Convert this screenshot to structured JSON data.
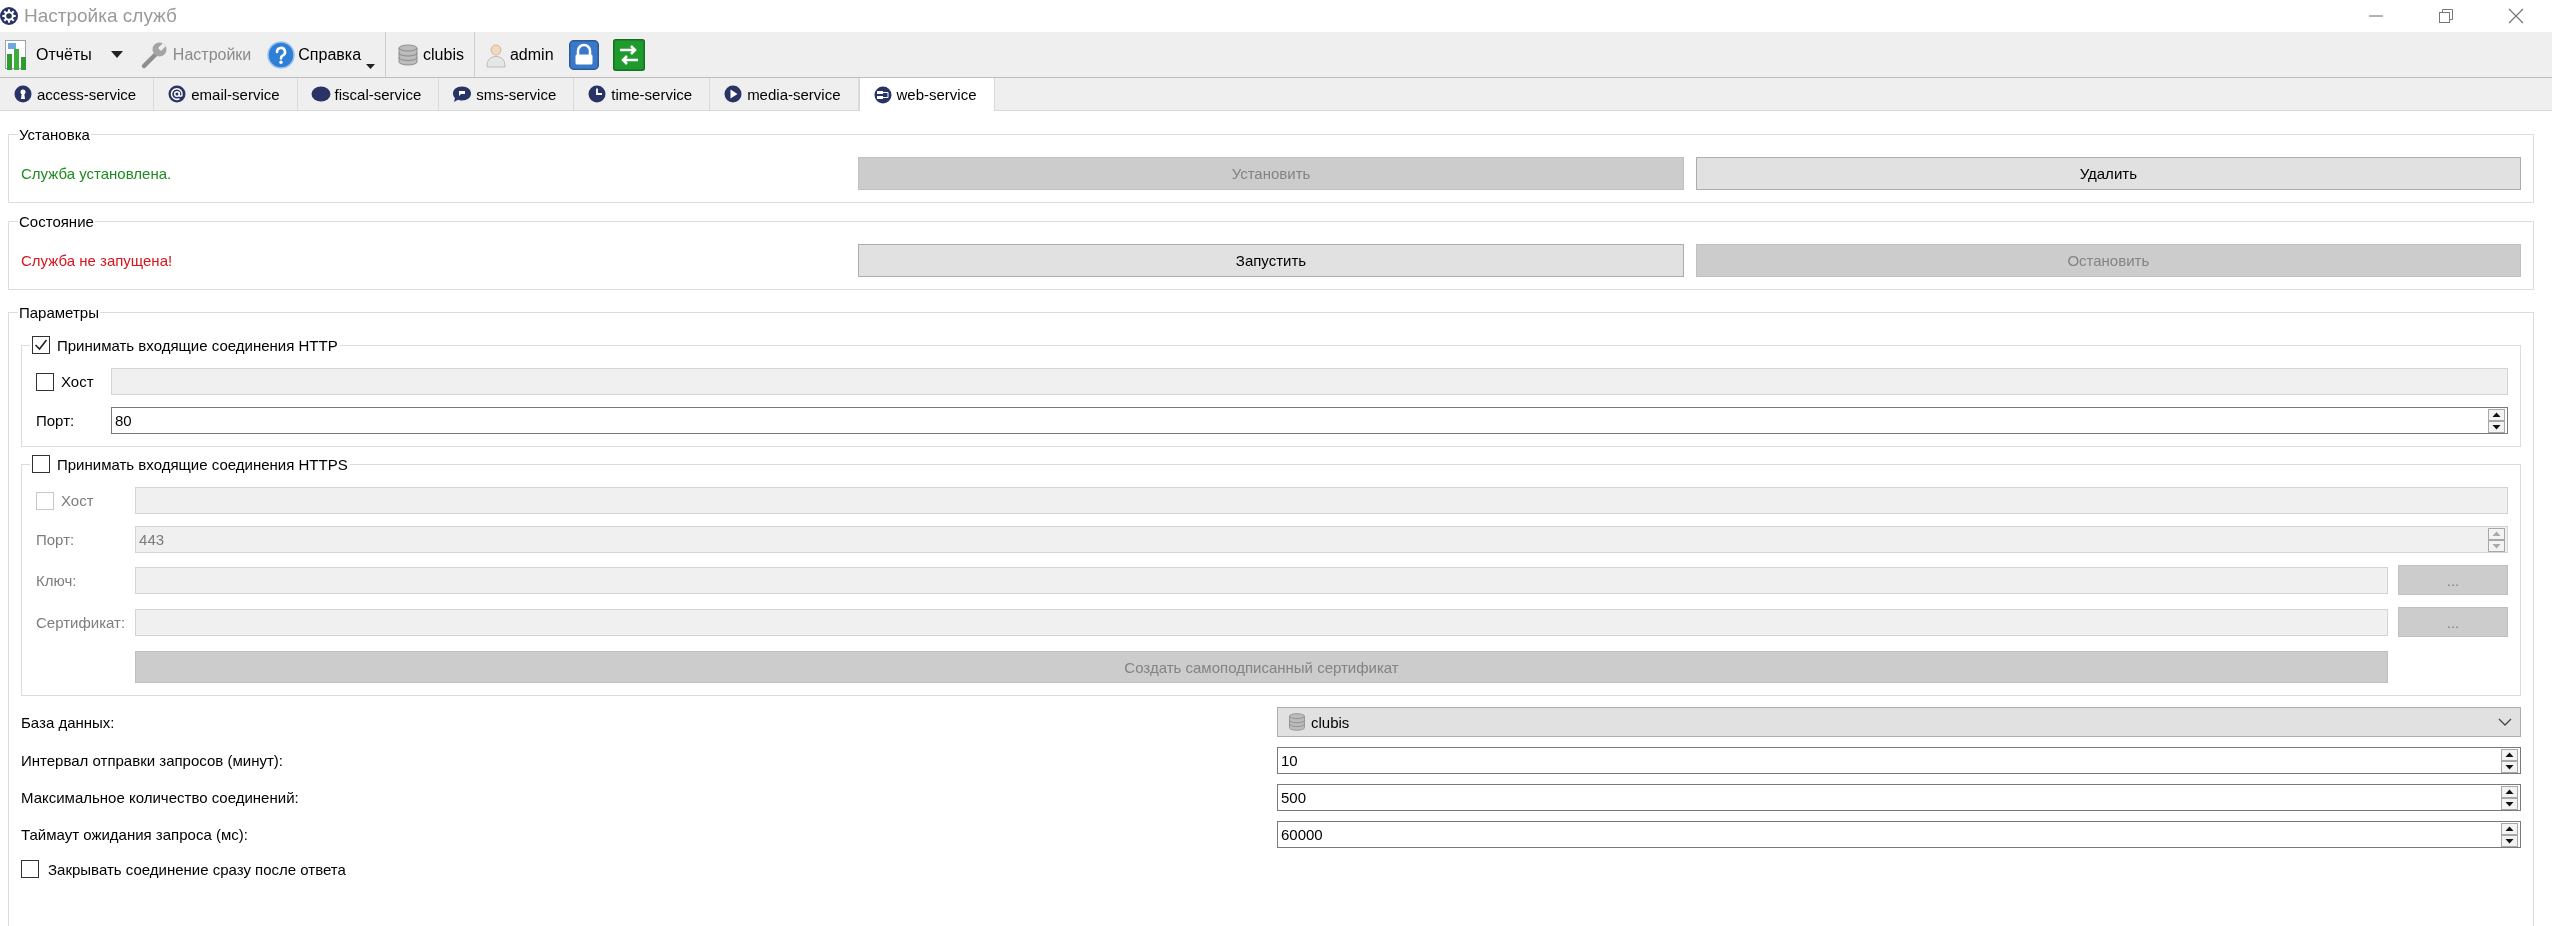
{
  "window": {
    "title": "Настройка служб"
  },
  "toolbar": {
    "groups": [
      [
        {
          "kind": "split-button",
          "label": "Отчёты",
          "disabled": false
        },
        {
          "kind": "button",
          "label": "Настройки",
          "disabled": true
        },
        {
          "kind": "menu-button",
          "label": "Справка",
          "disabled": false
        }
      ],
      [
        {
          "kind": "button",
          "label": "clubis",
          "disabled": false
        }
      ],
      [
        {
          "kind": "button",
          "label": "admin",
          "disabled": false
        },
        {
          "kind": "icon-button",
          "disabled": false
        },
        {
          "kind": "icon-button",
          "disabled": false
        }
      ]
    ]
  },
  "tabs": [
    {
      "label": "access-service",
      "selected": false
    },
    {
      "label": "email-service",
      "selected": false
    },
    {
      "label": "fiscal-service",
      "selected": false
    },
    {
      "label": "sms-service",
      "selected": false
    },
    {
      "label": "time-service",
      "selected": false
    },
    {
      "label": "media-service",
      "selected": false
    },
    {
      "label": "web-service",
      "selected": true
    }
  ],
  "sections": [
    {
      "title": "Установка",
      "status": {
        "text": "Служба установлена.",
        "kind": "success"
      },
      "buttons": [
        {
          "label": "Установить",
          "disabled": true
        },
        {
          "label": "Удалить",
          "disabled": false
        }
      ]
    },
    {
      "title": "Состояние",
      "status": {
        "text": "Служба не запущена!",
        "kind": "error"
      },
      "buttons": [
        {
          "label": "Запустить",
          "disabled": false
        },
        {
          "label": "Остановить",
          "disabled": true
        }
      ]
    }
  ],
  "parameters": {
    "title": "Параметры",
    "http": {
      "label": "Принимать входящие соединения HTTP",
      "checked": true,
      "host": {
        "label": "Хост",
        "checked": false
      },
      "port": {
        "label": "Порт:",
        "value": "80"
      }
    },
    "https": {
      "label": "Принимать входящие соединения HTTPS",
      "checked": false,
      "host": {
        "label": "Хост",
        "checked": false
      },
      "port": {
        "label": "Порт:",
        "value": "443"
      },
      "key": {
        "label": "Ключ:",
        "button": "..."
      },
      "certificate": {
        "label": "Сертификат:",
        "button": "..."
      },
      "generate_button": "Создать самоподписанный сертификат"
    },
    "settings": [
      {
        "kind": "combo",
        "label": "База данных:",
        "value": "clubis"
      },
      {
        "kind": "spin",
        "label": "Интервал отправки запросов (минут):",
        "value": "10"
      },
      {
        "kind": "spin",
        "label": "Максимальное количество соединений:",
        "value": "500"
      },
      {
        "kind": "spin",
        "label": "Таймаут ожидания запроса (мс):",
        "value": "60000"
      }
    ],
    "close_after_response": {
      "label": "Закрывать соединение сразу после ответа",
      "checked": false
    }
  }
}
